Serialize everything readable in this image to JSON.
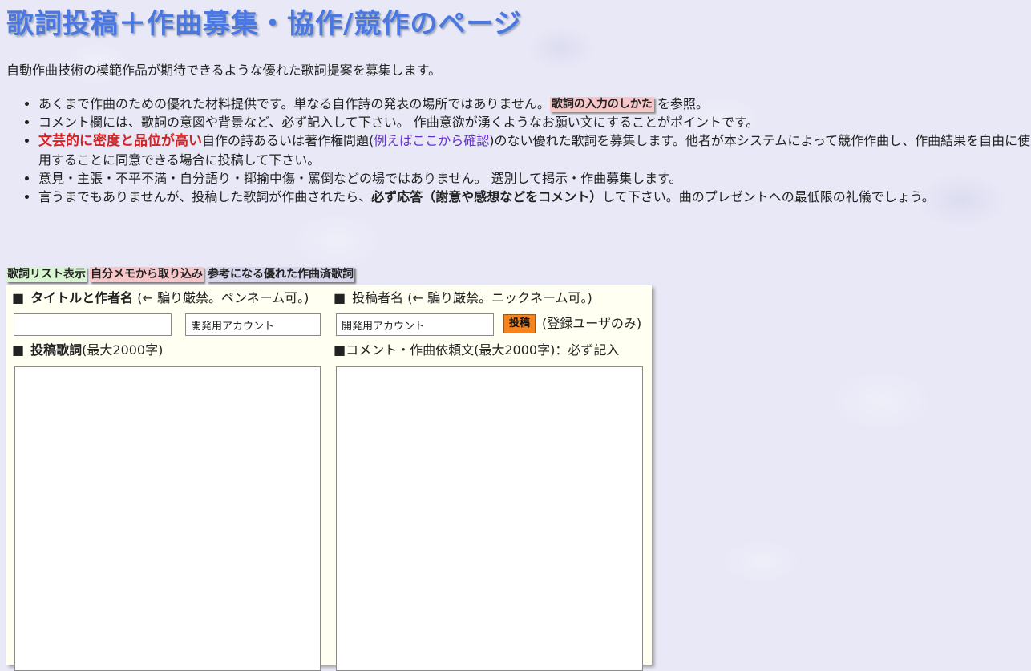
{
  "page": {
    "title": "歌詞投稿＋作曲募集・協作/競作のページ",
    "intro": "自動作曲技術の模範作品が期待できるような優れた歌詞提案を募集します。"
  },
  "notes": {
    "n1_text": "あくまで作曲のための優れた材料提供です。単なる自作詩の発表の場所ではありません。",
    "n1_button": "歌詞の入力のしかた",
    "n1_suffix": "を参照。",
    "n2_text": "コメント欄には、歌詞の意図や背景など、必ず記入して下さい。 作曲意欲が湧くようなお願い文にすることがポイントです。",
    "n3_strong": "文芸的に密度と品位が高い",
    "n3_text1": "自作の詩あるいは著作権問題(",
    "n3_link": "例えばここから確認",
    "n3_text2": ")のない優れた歌詞を募集します。他者が本システムによって競作作曲し、作曲結果を自由に使用することに同意できる場合に投稿して下さい。",
    "n4_text": "意見・主張・不平不満・自分語り・揶揄中傷・罵倒などの場ではありません。 選別して掲示・作曲募集します。",
    "n5_text1": "言うまでもありませんが、投稿した歌詞が作曲されたら、",
    "n5_bold": "必ず応答（謝意や感想などをコメント）",
    "n5_text2": "して下さい。曲のプレゼントへの最低限の礼儀でしょう。"
  },
  "tabs": {
    "list": "歌詞リスト表示",
    "memo": "自分メモから取り込み",
    "reference": "参考になる優れた作曲済歌詞"
  },
  "form": {
    "square": "■",
    "title_label_bold": "タイトルと作者名",
    "title_label_note": " (← 騙り厳禁。ペンネーム可。)",
    "poster_label": "投稿者名 (← 騙り厳禁。ニックネーム可。)",
    "title_value": "",
    "author_value": "開発用アカウント",
    "poster_value": "開発用アカウント",
    "post_button": "投稿",
    "post_note": "(登録ユーザのみ)",
    "lyrics_label_bold": "投稿歌詞",
    "lyrics_label_note": "(最大2000字)",
    "comment_label": "コメント・作曲依頼文(最大2000字)：必ず記入",
    "lyrics_value": "",
    "comment_value": ""
  }
}
